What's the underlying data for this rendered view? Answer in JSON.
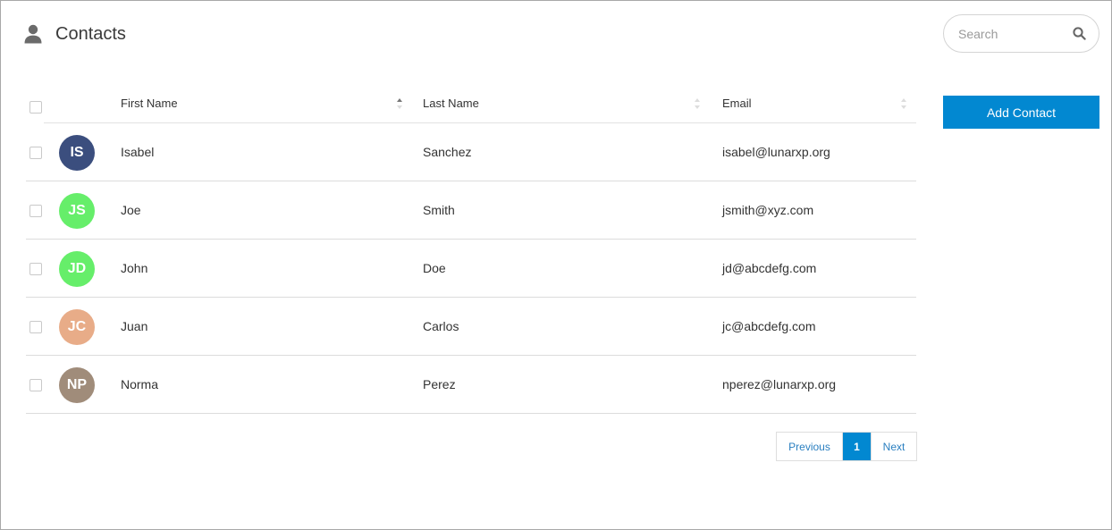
{
  "header": {
    "title": "Contacts",
    "icon": "user-icon"
  },
  "search": {
    "placeholder": "Search",
    "value": "",
    "icon": "search-icon"
  },
  "actions": {
    "add_label": "Add Contact",
    "accent": "#0288d1"
  },
  "table": {
    "columns": [
      {
        "label": "First Name",
        "sort": "ascending"
      },
      {
        "label": "Last Name",
        "sort": "none"
      },
      {
        "label": "Email",
        "sort": "none"
      }
    ],
    "rows": [
      {
        "initials": "IS",
        "avatar_color": "#3b4e7e",
        "first": "Isabel",
        "last": "Sanchez",
        "email": "isabel@lunarxp.org"
      },
      {
        "initials": "JS",
        "avatar_color": "#66ee6a",
        "first": "Joe",
        "last": "Smith",
        "email": "jsmith@xyz.com"
      },
      {
        "initials": "JD",
        "avatar_color": "#66ee6a",
        "first": "John",
        "last": "Doe",
        "email": "jd@abcdefg.com"
      },
      {
        "initials": "JC",
        "avatar_color": "#e8ac88",
        "first": "Juan",
        "last": "Carlos",
        "email": "jc@abcdefg.com"
      },
      {
        "initials": "NP",
        "avatar_color": "#a08c7a",
        "first": "Norma",
        "last": "Perez",
        "email": "nperez@lunarxp.org"
      }
    ]
  },
  "pagination": {
    "previous": "Previous",
    "current": "1",
    "next": "Next"
  }
}
